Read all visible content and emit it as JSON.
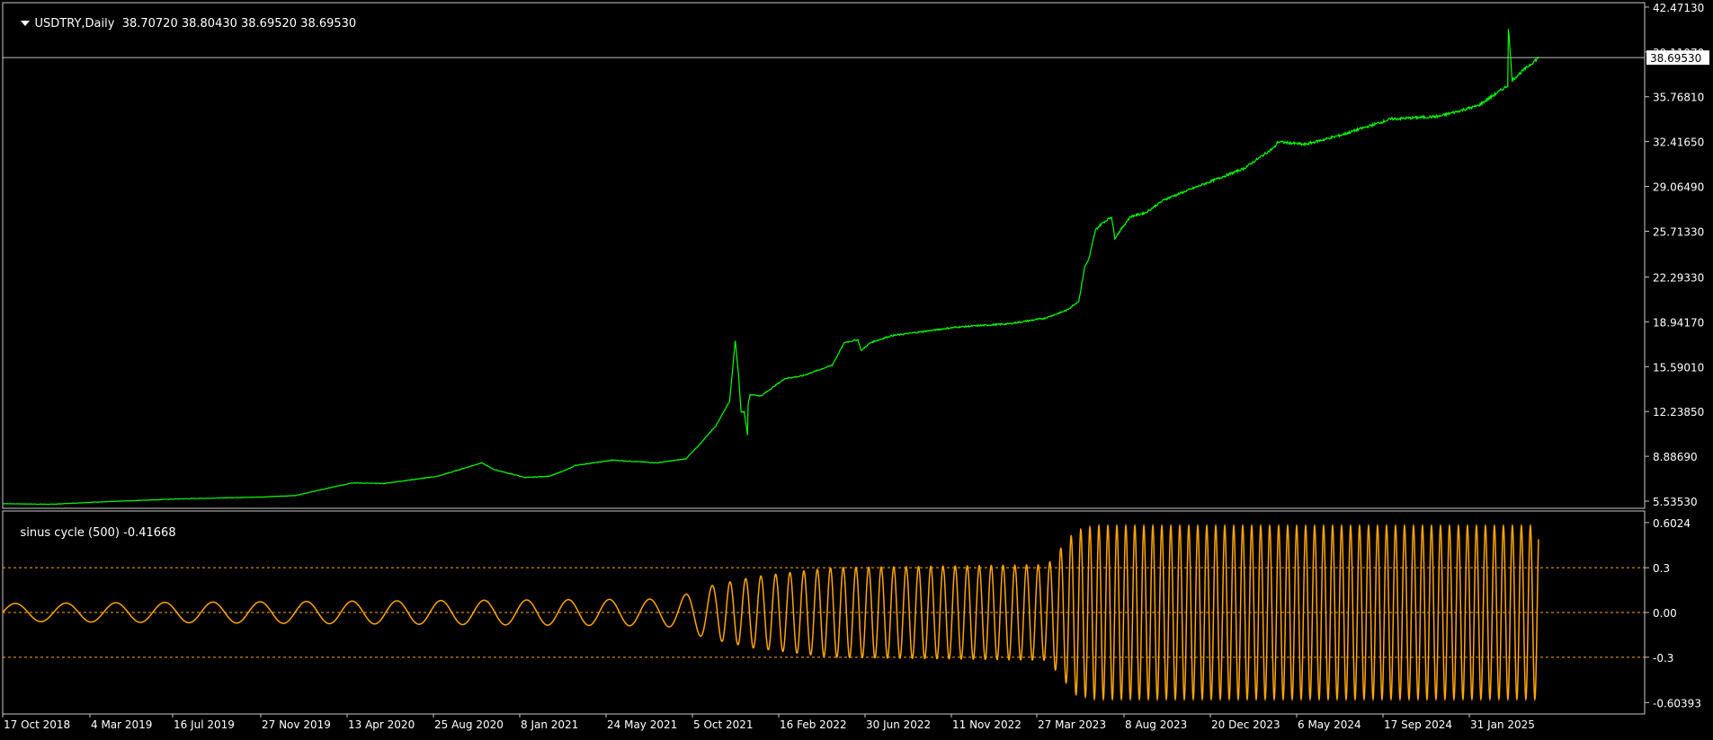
{
  "colors": {
    "background": "#000000",
    "frame": "#c8c8c8",
    "price_line": "#00ff00",
    "oscillator_line": "#ffa500",
    "level_line": "#ffa500",
    "axis_text": "#ffffff",
    "bid_line": "#c0c0c0",
    "current_price_bg": "#ffffff",
    "current_price_text": "#000000"
  },
  "main_title": {
    "symbol_timeframe": "USDTRY,Daily",
    "ohlc": "38.70720 38.80430 38.69520 38.69530"
  },
  "sub_title": {
    "indicator": "sinus cycle (500)",
    "value": "-0.41668"
  },
  "current_price_label": "38.69530",
  "chart_data": [
    {
      "type": "line",
      "name": "USDTRY Daily close",
      "y_axis_ticks": [
        "42.47130",
        "39.11970",
        "35.76810",
        "32.41650",
        "29.06490",
        "25.71330",
        "22.29330",
        "18.94170",
        "15.59010",
        "12.23850",
        "8.88690",
        "5.53530"
      ],
      "ylim": [
        5.0,
        42.8
      ],
      "x_tick_labels": [
        "17 Oct 2018",
        "4 Mar 2019",
        "16 Jul 2019",
        "27 Nov 2019",
        "13 Apr 2020",
        "25 Aug 2020",
        "8 Jan 2021",
        "24 May 2021",
        "5 Oct 2021",
        "16 Feb 2022",
        "30 Jun 2022",
        "11 Nov 2022",
        "27 Mar 2023",
        "8 Aug 2023",
        "20 Dec 2023",
        "6 May 2024",
        "17 Sep 2024",
        "31 Jan 2025"
      ],
      "x_dates": [
        "2018-10-17",
        "2019-01-01",
        "2019-03-04",
        "2019-07-16",
        "2019-11-27",
        "2020-01-15",
        "2020-04-13",
        "2020-06-01",
        "2020-08-25",
        "2020-11-01",
        "2020-11-20",
        "2021-01-08",
        "2021-02-15",
        "2021-03-19",
        "2021-03-26",
        "2021-05-24",
        "2021-08-01",
        "2021-09-15",
        "2021-10-05",
        "2021-11-01",
        "2021-11-22",
        "2021-12-01",
        "2021-12-06",
        "2021-12-10",
        "2021-12-15",
        "2021-12-20",
        "2021-12-21",
        "2021-12-24",
        "2022-01-10",
        "2022-02-16",
        "2022-03-15",
        "2022-05-01",
        "2022-05-20",
        "2022-06-10",
        "2022-06-15",
        "2022-06-30",
        "2022-08-01",
        "2022-11-11",
        "2023-02-01",
        "2023-03-27",
        "2023-05-01",
        "2023-05-20",
        "2023-05-29",
        "2023-06-05",
        "2023-06-15",
        "2023-06-25",
        "2023-07-10",
        "2023-07-15",
        "2023-08-08",
        "2023-09-01",
        "2023-10-01",
        "2023-12-20",
        "2024-02-01",
        "2024-03-20",
        "2024-03-25",
        "2024-05-06",
        "2024-07-01",
        "2024-09-17",
        "2024-12-01",
        "2025-01-31",
        "2025-03-18",
        "2025-03-19",
        "2025-03-25",
        "2025-04-10",
        "2025-05-05"
      ],
      "values": [
        5.35,
        5.3,
        5.45,
        5.7,
        5.85,
        5.95,
        6.9,
        6.85,
        7.4,
        8.4,
        7.9,
        7.3,
        7.4,
        8.0,
        8.2,
        8.6,
        8.4,
        8.7,
        9.7,
        11.2,
        13.0,
        17.5,
        15.0,
        12.2,
        12.2,
        10.5,
        12.8,
        13.5,
        13.4,
        14.7,
        14.9,
        15.7,
        17.4,
        17.6,
        16.8,
        17.4,
        17.9,
        18.55,
        18.8,
        19.2,
        19.8,
        20.5,
        23.0,
        23.7,
        25.8,
        26.3,
        26.8,
        25.2,
        26.8,
        27.1,
        28.1,
        29.6,
        30.4,
        32.0,
        32.4,
        32.2,
        32.9,
        34.1,
        34.3,
        35.1,
        36.6,
        40.95,
        37.0,
        37.7,
        38.69
      ],
      "current_price": 38.6953
    },
    {
      "type": "line",
      "name": "sinus cycle (500)",
      "y_axis_ticks": [
        "0.6024",
        "0.3",
        "0.00",
        "-0.3",
        "-0.60393"
      ],
      "ylim": [
        -0.68,
        0.68
      ],
      "levels": [
        0.3,
        0.0,
        -0.3
      ],
      "x_start": "2018-10-17",
      "x_end": "2025-05-05",
      "amplitude_by_date": [
        [
          "2018-10-17",
          0.06
        ],
        [
          "2021-08-01",
          0.09
        ],
        [
          "2021-09-01",
          0.1
        ],
        [
          "2021-10-15",
          0.17
        ],
        [
          "2022-01-01",
          0.24
        ],
        [
          "2022-05-01",
          0.3
        ],
        [
          "2023-04-01",
          0.32
        ],
        [
          "2023-05-15",
          0.55
        ],
        [
          "2023-06-15",
          0.58
        ],
        [
          "2025-05-05",
          0.58
        ]
      ],
      "period_days_by_date": [
        [
          "2018-10-17",
          80
        ],
        [
          "2021-08-01",
          62
        ],
        [
          "2021-10-01",
          44
        ],
        [
          "2021-11-15",
          25
        ],
        [
          "2022-05-01",
          20
        ],
        [
          "2023-04-01",
          18
        ],
        [
          "2023-06-01",
          14
        ],
        [
          "2025-05-05",
          14
        ]
      ],
      "last_value": -0.41668
    }
  ]
}
